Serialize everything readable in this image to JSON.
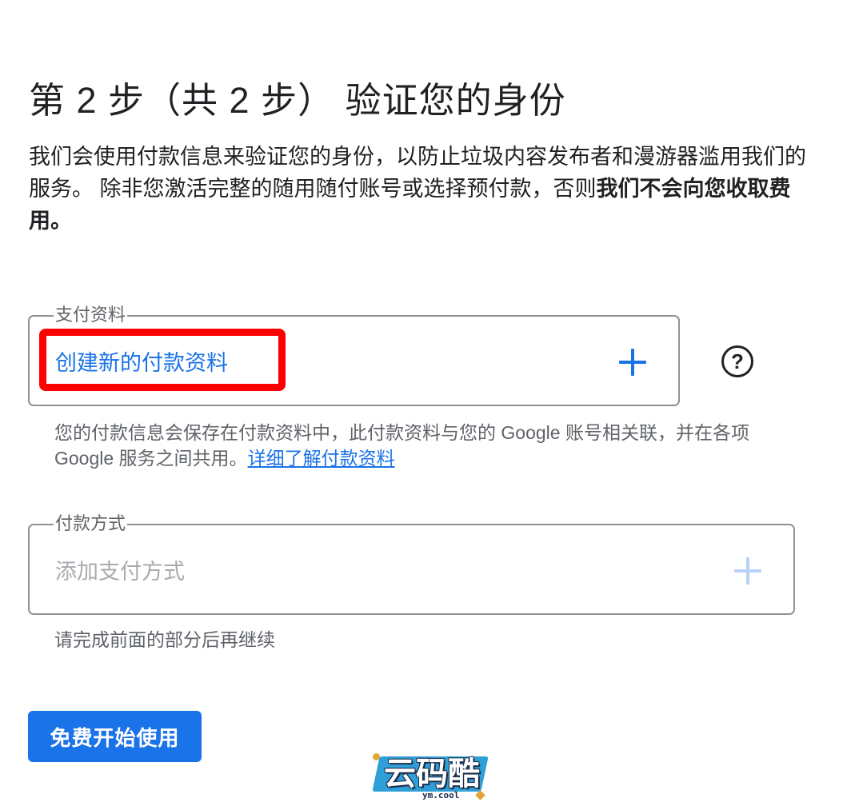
{
  "header": {
    "title": "第 2 步（共 2 步） 验证您的身份"
  },
  "intro": {
    "text": "我们会使用付款信息来验证您的身份，以防止垃圾内容发布者和漫游器滥用我们的服务。 除非您激活完整的随用随付账号或选择预付款，否则",
    "bold_text": "我们不会向您收取费用。"
  },
  "payment_profile": {
    "legend": "支付资料",
    "value": "创建新的付款资料",
    "help_icon": "help-circle-icon",
    "add_icon": "plus-icon",
    "hint": "您的付款信息会保存在付款资料中，此付款资料与您的 Google 账号相关联，并在各项 Google 服务之间共用。",
    "learn_more_link": "详细了解付款资料",
    "highlight_color": "#ff0000"
  },
  "payment_method": {
    "legend": "付款方式",
    "placeholder": "添加支付方式",
    "add_icon": "plus-icon",
    "hint": "请完成前面的部分后再继续"
  },
  "cta": {
    "label": "免费开始使用",
    "color": "#1a73e8"
  },
  "watermark": {
    "text": "云码酷",
    "subtext": "ym.cool"
  }
}
